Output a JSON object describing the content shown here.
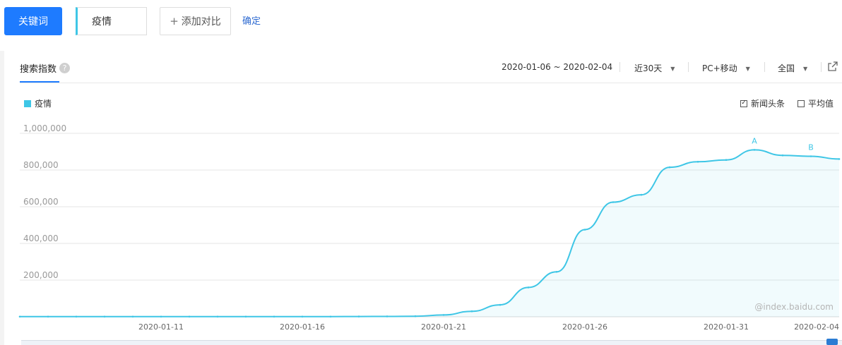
{
  "toolbar": {
    "keyword_button": "关键词",
    "keyword_value": "疫情",
    "add_compare_icon": "plus-icon",
    "add_compare_label": "添加对比",
    "confirm_label": "确定"
  },
  "panel": {
    "tab_label": "搜索指数",
    "help_icon": "question-icon",
    "date_range": "2020-01-06 ~ 2020-02-04",
    "period_label": "近30天",
    "device_label": "PC+移动",
    "region_label": "全国",
    "export_icon": "external-link-icon",
    "legend_label": "疫情",
    "option_news": "新闻头条",
    "option_news_checked": true,
    "option_avg": "平均值",
    "option_avg_checked": false,
    "watermark": "@index.baidu.com"
  },
  "colors": {
    "accent": "#1e7bff",
    "series": "#3ec6e6",
    "link": "#2f6bd1"
  },
  "chart_data": {
    "type": "area",
    "series": [
      {
        "name": "疫情",
        "x": [
          "2020-01-06",
          "2020-01-07",
          "2020-01-08",
          "2020-01-09",
          "2020-01-10",
          "2020-01-11",
          "2020-01-12",
          "2020-01-13",
          "2020-01-14",
          "2020-01-15",
          "2020-01-16",
          "2020-01-17",
          "2020-01-18",
          "2020-01-19",
          "2020-01-20",
          "2020-01-21",
          "2020-01-22",
          "2020-01-23",
          "2020-01-24",
          "2020-01-25",
          "2020-01-26",
          "2020-01-27",
          "2020-01-28",
          "2020-01-29",
          "2020-01-30",
          "2020-01-31",
          "2020-02-01",
          "2020-02-02",
          "2020-02-03",
          "2020-02-04"
        ],
        "values": [
          1000,
          1000,
          1000,
          1000,
          1000,
          1000,
          1000,
          1000,
          1000,
          1000,
          1000,
          1000,
          1500,
          2000,
          3000,
          10000,
          30000,
          65000,
          160000,
          245000,
          475000,
          625000,
          665000,
          815000,
          845000,
          855000,
          910000,
          880000,
          875000,
          860000
        ]
      }
    ],
    "yticks": [
      "1,000,000",
      "800,000",
      "600,000",
      "400,000",
      "200,000"
    ],
    "xticks": [
      "2020-01-11",
      "2020-01-16",
      "2020-01-21",
      "2020-01-26",
      "2020-01-31",
      "2020-02-04"
    ],
    "ylim": [
      0,
      1000000
    ],
    "grid": true,
    "markers": [
      {
        "label": "A",
        "x": "2020-02-01",
        "value": 910000
      },
      {
        "label": "B",
        "x": "2020-02-03",
        "value": 875000
      }
    ]
  }
}
